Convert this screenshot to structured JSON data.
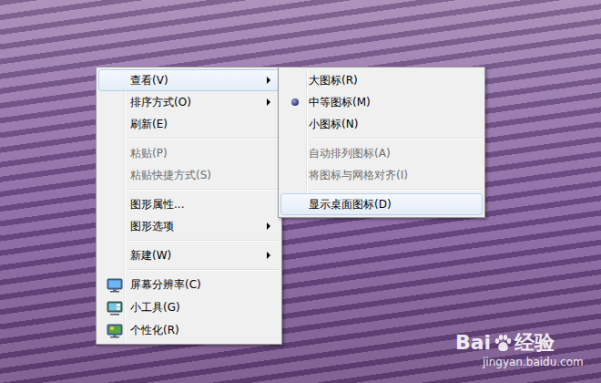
{
  "desktop": {
    "wallpaper": "lavender field photo"
  },
  "context_menu": {
    "items": [
      {
        "kind": "item",
        "label": "查看(V)",
        "has_submenu": true,
        "highlighted": true,
        "disabled": false,
        "has_icon": false
      },
      {
        "kind": "item",
        "label": "排序方式(O)",
        "has_submenu": true,
        "highlighted": false,
        "disabled": false,
        "has_icon": false
      },
      {
        "kind": "item",
        "label": "刷新(E)",
        "has_submenu": false,
        "highlighted": false,
        "disabled": false,
        "has_icon": false
      },
      {
        "kind": "separator"
      },
      {
        "kind": "item",
        "label": "粘贴(P)",
        "has_submenu": false,
        "highlighted": false,
        "disabled": true,
        "has_icon": false
      },
      {
        "kind": "item",
        "label": "粘贴快捷方式(S)",
        "has_submenu": false,
        "highlighted": false,
        "disabled": true,
        "has_icon": false
      },
      {
        "kind": "separator"
      },
      {
        "kind": "item",
        "label": "图形属性...",
        "has_submenu": false,
        "highlighted": false,
        "disabled": false,
        "has_icon": false
      },
      {
        "kind": "item",
        "label": "图形选项",
        "has_submenu": true,
        "highlighted": false,
        "disabled": false,
        "has_icon": false
      },
      {
        "kind": "separator"
      },
      {
        "kind": "item",
        "label": "新建(W)",
        "has_submenu": true,
        "highlighted": false,
        "disabled": false,
        "has_icon": false
      },
      {
        "kind": "separator"
      },
      {
        "kind": "item",
        "label": "屏幕分辨率(C)",
        "has_submenu": false,
        "highlighted": false,
        "disabled": false,
        "has_icon": true
      },
      {
        "kind": "item",
        "label": "小工具(G)",
        "has_submenu": false,
        "highlighted": false,
        "disabled": false,
        "has_icon": true
      },
      {
        "kind": "item",
        "label": "个性化(R)",
        "has_submenu": false,
        "highlighted": false,
        "disabled": false,
        "has_icon": true
      }
    ]
  },
  "submenu": {
    "parent": "查看(V)",
    "items": [
      {
        "kind": "item",
        "label": "大图标(R)",
        "selected": false,
        "highlighted": false,
        "disabled": false
      },
      {
        "kind": "item",
        "label": "中等图标(M)",
        "selected": true,
        "highlighted": false,
        "disabled": false
      },
      {
        "kind": "item",
        "label": "小图标(N)",
        "selected": false,
        "highlighted": false,
        "disabled": false
      },
      {
        "kind": "separator"
      },
      {
        "kind": "item",
        "label": "自动排列图标(A)",
        "selected": false,
        "highlighted": false,
        "disabled": true
      },
      {
        "kind": "item",
        "label": "将图标与网格对齐(I)",
        "selected": false,
        "highlighted": false,
        "disabled": true
      },
      {
        "kind": "separator"
      },
      {
        "kind": "item",
        "label": "显示桌面图标(D)",
        "selected": false,
        "highlighted": true,
        "disabled": false
      }
    ]
  },
  "watermark": {
    "brand": "Bai",
    "brand_suffix": "经验",
    "url": "jingyan.baidu.com"
  }
}
